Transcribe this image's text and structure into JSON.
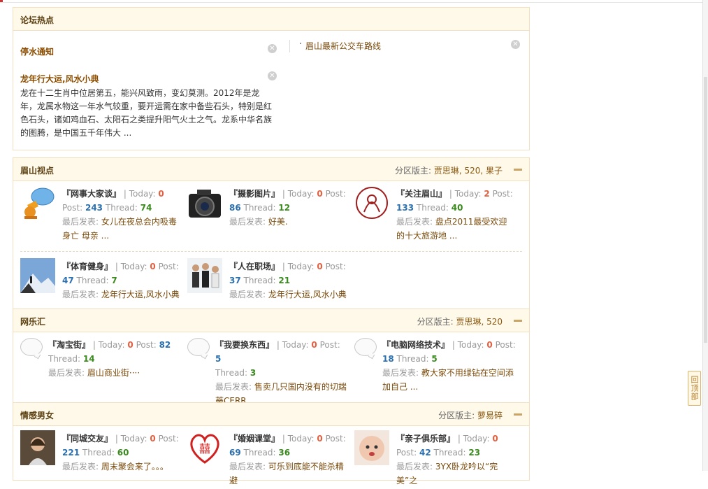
{
  "ui": {
    "back_to_top": "回顶部"
  },
  "hot": {
    "title": "论坛热点",
    "items": [
      {
        "title": "停水通知"
      },
      {
        "title": "龙年行大运,风水小典",
        "desc": "龙在十二生肖中位居第五，能兴风致雨，变幻莫测。2012年是龙年，龙属水物这一年水气较重，要开运需在家中备些石头，特别是红色石头，诸如鸡血石、太阳石之类提升阳气火土之气。龙系中华名族的图腾，是中国五千年伟大 ..."
      }
    ],
    "right_link": "眉山最新公交车路线"
  },
  "labels": {
    "today": "Today:",
    "post": "Post:",
    "thread": "Thread:",
    "last": "最后发表:",
    "mod": "分区版主:"
  },
  "sections": [
    {
      "title": "眉山视点",
      "mods": "贾思琳, 520, 果子",
      "forums": [
        {
          "name": "『网事大家谈』",
          "today": "0",
          "post": "243",
          "thread": "74",
          "last": "女儿在夜总会内吸毒身亡 母亲 ...",
          "icon": "megaphone-icon"
        },
        {
          "name": "『摄影图片』",
          "today": "0",
          "post": "86",
          "thread": "12",
          "last": "好美.",
          "icon": "camera-icon"
        },
        {
          "name": "『关注眉山』",
          "today": "2",
          "post": "133",
          "thread": "40",
          "last": "盘点2011最受欢迎的十大旅游地 ...",
          "icon": "portrait-icon"
        },
        {
          "name": "『体育健身』",
          "today": "0",
          "post": "47",
          "thread": "7",
          "last": "龙年行大运,风水小典",
          "icon": "climber-icon"
        },
        {
          "name": "『人在职场』",
          "today": "0",
          "post": "37",
          "thread": "21",
          "last": "龙年行大运,风水小典",
          "icon": "office-people-icon"
        }
      ]
    },
    {
      "title": "网乐汇",
      "mods": "贾思琳, 520",
      "forums": [
        {
          "name": "『淘宝街』",
          "today": "0",
          "post": "82",
          "thread": "14",
          "last": "眉山商业街····",
          "icon": "speech-bubble-icon"
        },
        {
          "name": "『我要换东西』",
          "today": "0",
          "post": "5",
          "thread": "3",
          "last": "售卖几只国内没有的切端蒂CERR ...",
          "icon": "speech-bubble-icon"
        },
        {
          "name": "『电脑网络技术』",
          "today": "0",
          "post": "18",
          "thread": "5",
          "last": "教大家不用绿钻在空间添加自己 ...",
          "icon": "speech-bubble-icon"
        }
      ]
    },
    {
      "title": "情感男女",
      "mods": "萝易碎",
      "forums": [
        {
          "name": "『同城交友』",
          "today": "0",
          "post": "221",
          "thread": "60",
          "last": "周末聚会来了。。。",
          "icon": "woman-photo-icon"
        },
        {
          "name": "『婚姻课堂』",
          "today": "0",
          "post": "69",
          "thread": "36",
          "last": "可乐到底能不能杀精避",
          "icon": "double-happiness-icon"
        },
        {
          "name": "『亲子俱乐部』",
          "today": "0",
          "post": "42",
          "thread": "23",
          "last": "3YX卧龙吟以“完美”之",
          "icon": "baby-photo-icon"
        }
      ]
    }
  ]
}
